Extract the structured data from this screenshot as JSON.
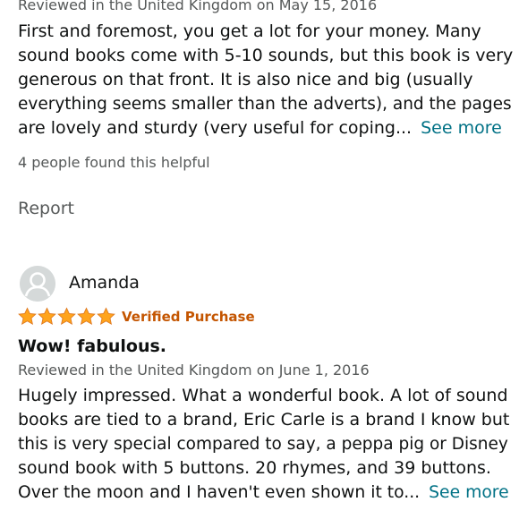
{
  "review1": {
    "date": "Reviewed in the United Kingdom on May 15, 2016",
    "body_lines": [
      "First and foremost, you get a lot for your money. Many",
      "sound books come with 5-10 sounds, but this book is very",
      "generous on that front. It is also nice and big (usually",
      "everything seems smaller than the adverts), and the pages",
      "are lovely and sturdy (very useful for coping..."
    ],
    "see_more": "See more",
    "helpful": "4 people found this helpful",
    "report": "Report"
  },
  "review2": {
    "author": "Amanda",
    "rating": 5,
    "verified": "Verified Purchase",
    "title": "Wow! fabulous.",
    "date": "Reviewed in the United Kingdom on June 1, 2016",
    "body_lines": [
      "Hugely impressed. What a wonderful book. A lot of sound",
      "books are tied to a brand, Eric Carle is a brand I know but",
      "this is very special compared to say, a peppa pig or Disney",
      "sound book with 5 buttons. 20 rhymes, and 39 buttons.",
      "Over the moon and I haven't even shown it to..."
    ],
    "see_more": "See more"
  },
  "colors": {
    "link": "#007185",
    "star": "#ffa41c",
    "verified": "#c45500",
    "muted": "#565959"
  },
  "icons": {
    "avatar": "default-user-avatar-icon",
    "star": "star-icon"
  }
}
